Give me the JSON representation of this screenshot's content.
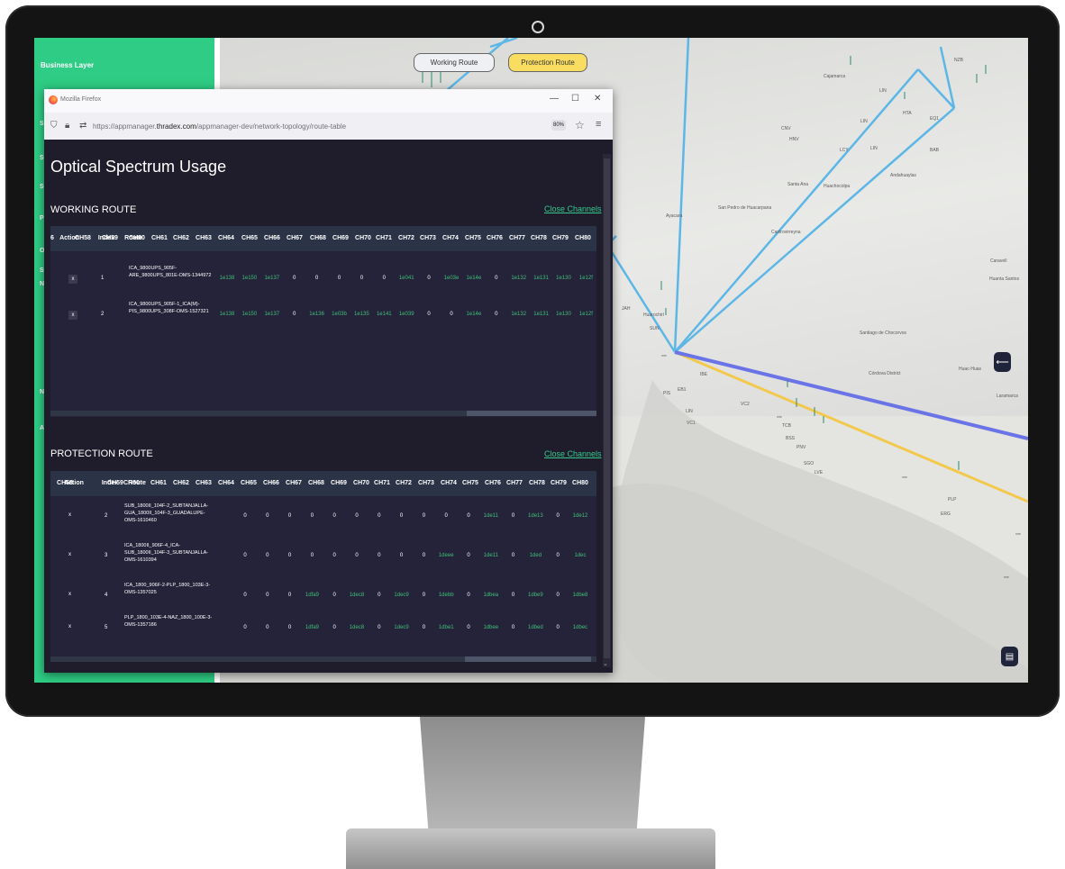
{
  "sidebar": {
    "business_layer": "Business Layer",
    "letters": [
      "S",
      "S",
      "S",
      "P",
      "O",
      "S",
      "N",
      "N",
      "A"
    ]
  },
  "map": {
    "route_buttons": {
      "working": "Working Route",
      "protection": "Protection Route"
    },
    "back_button_icon": "arrow-left-icon",
    "layers_button_icon": "layers-icon",
    "colors": {
      "working_route": "#6b74e6",
      "protection_route": "#f2c94c",
      "links": "#5cb6e6"
    },
    "labels": [
      "LIN",
      "PIS",
      "SUN",
      "EB1",
      "LIN",
      "VC1",
      "VC2",
      "IBE",
      "TCB",
      "PNV",
      "SGO",
      "LVE",
      "BSS",
      "PLP",
      "ERG",
      "HTA",
      "NZB",
      "BAB",
      "EQ1",
      "CNV",
      "LCY",
      "LIN",
      "LIN",
      "LIN",
      "HNV",
      "JAH",
      "Huarochirí",
      "Santiago de Chocorvos",
      "Córdova District",
      "Huac-Huas",
      "Laramarca",
      "Huanta Santos",
      "Caravelí",
      "San Pedro de Huacarpana",
      "Castrovirreyna",
      "Ayacara",
      "Santa Ana",
      "Huachocolpa",
      "Andahuaylas",
      "Cajamarca",
      "***",
      "***",
      "***",
      "***",
      "***"
    ]
  },
  "browser": {
    "window_title": "Mozilla Firefox",
    "url_prefix": "https://appmanager.",
    "url_domain": "thradex.com",
    "url_path": "/appmanager-dev/network-topology/route-table",
    "zoom": "80%",
    "controls": {
      "minimize": "—",
      "maximize": "☐",
      "close": "✕"
    }
  },
  "page": {
    "title": "Optical Spectrum Usage",
    "working": {
      "section_title": "WORKING ROUTE",
      "close_channels": "Close Channels",
      "headers": [
        "6",
        "Action",
        "CH58",
        "Index",
        "CH59",
        "Route",
        "CH60",
        "CH61",
        "CH62",
        "CH63",
        "CH64",
        "CH65",
        "CH66",
        "CH67",
        "CH68",
        "CH69",
        "CH70",
        "CH71",
        "CH72",
        "CH73",
        "CH74",
        "CH75",
        "CH76",
        "CH77",
        "CH78",
        "CH79",
        "CH80"
      ],
      "rows": [
        {
          "action": "x",
          "index": "1",
          "route": "ICA_9800UPS_905F-ARE_9800UPS_801E-OMS-1344972",
          "cells": [
            "1e138",
            "1e150",
            "1e137",
            "0",
            "0",
            "0",
            "0",
            "0",
            "1e041",
            "0",
            "1e03e",
            "1e14e",
            "0",
            "1e132",
            "1e131",
            "1e130",
            "1e12f"
          ]
        },
        {
          "action": "x",
          "index": "2",
          "route": "ICA_9800UPS_905F-1_ICA(M)-PIS_9800UPS_308F-OMS-1527321",
          "cells": [
            "1e138",
            "1e150",
            "1e137",
            "0",
            "1e136",
            "1e03b",
            "1e135",
            "1e141",
            "1e039",
            "0",
            "0",
            "1e14e",
            "0",
            "1e132",
            "1e131",
            "1e130",
            "1e12f"
          ]
        }
      ]
    },
    "protection": {
      "section_title": "PROTECTION ROUTE",
      "close_channels": "Close Channels",
      "headers": [
        "CH58",
        "Action",
        "Index",
        "CH59",
        "CH60",
        "Route",
        "CH61",
        "CH62",
        "CH63",
        "CH64",
        "CH65",
        "CH66",
        "CH67",
        "CH68",
        "CH69",
        "CH70",
        "CH71",
        "CH72",
        "CH73",
        "CH74",
        "CH75",
        "CH76",
        "CH77",
        "CH78",
        "CH79",
        "CH80"
      ],
      "rows": [
        {
          "action": "x",
          "index": "2",
          "route": "SUB_1800II_104F-2_SUBTANJALLA-GUA_1800II_104F-3_GUADALUPE-OMS-1610460",
          "cells": [
            "0",
            "0",
            "0",
            "0",
            "0",
            "0",
            "0",
            "0",
            "0",
            "0",
            "0",
            "1de11",
            "0",
            "1de13",
            "0",
            "1de12"
          ]
        },
        {
          "action": "x",
          "index": "3",
          "route": "ICA_1800II_906F-4_ICA-SUB_1800II_104F-3_SUBTANJALLA-OMS-1610394",
          "cells": [
            "0",
            "0",
            "0",
            "0",
            "0",
            "0",
            "0",
            "0",
            "0",
            "1deee",
            "0",
            "1de11",
            "0",
            "1ded",
            "0",
            "1dec"
          ]
        },
        {
          "action": "x",
          "index": "4",
          "route": "ICA_1800_906F-2-PLP_1800_103E-3-OMS-1357025",
          "cells": [
            "0",
            "0",
            "0",
            "1dfa9",
            "0",
            "1dec8",
            "0",
            "1dec9",
            "0",
            "1debb",
            "0",
            "1dbea",
            "0",
            "1dbe9",
            "0",
            "1dbe8"
          ]
        },
        {
          "action": "x",
          "index": "5",
          "route": "PLP_1800_103E-4-NAZ_1800_100E-3-OMS-1357186",
          "cells": [
            "0",
            "0",
            "0",
            "1dfa9",
            "0",
            "1dec8",
            "0",
            "1dec9",
            "0",
            "1dbe1",
            "0",
            "1dbee",
            "0",
            "1dbed",
            "0",
            "1dbec"
          ]
        }
      ]
    }
  },
  "icons": {
    "shield": "shield-icon",
    "lock": "lock-icon",
    "permissions": "permissions-icon",
    "star": "bookmark-star-icon",
    "menu": "menu-icon",
    "firefox": "firefox-logo-icon",
    "scroll_down": "scroll-down-icon"
  }
}
